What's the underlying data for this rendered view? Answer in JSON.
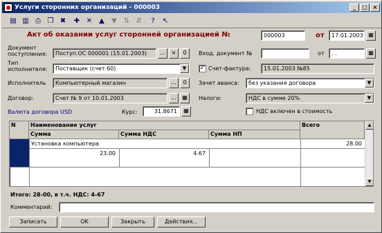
{
  "window": {
    "title": "Услуги сторонних организаций - 000003",
    "min_glyph": "_",
    "max_glyph": "□",
    "close_glyph": "×"
  },
  "toolbar": {
    "icons": [
      "save-icon",
      "save-close-icon",
      "print-icon",
      "copy-icon",
      "delete-icon",
      "new-row-icon",
      "delete-row-icon",
      "up-icon",
      "down-icon",
      "sort-asc-icon",
      "sort-desc-icon",
      "help-icon",
      "whats-this-icon"
    ],
    "glyphs": [
      "▤",
      "▥",
      "⎙",
      "❐",
      "✖",
      "✚",
      "✕",
      "▲",
      "▼",
      "⇅",
      "⇵",
      "?",
      "↖"
    ]
  },
  "header": {
    "heading": "Акт об оказании услуг сторонней организацией №",
    "number": "000003",
    "from_label": "от",
    "date": "17.01.2003"
  },
  "form": {
    "doc_receipt_label_1": "Документ",
    "doc_receipt_label_2": "поступления:",
    "doc_receipt_value": "Поступ.ОС 000001 (15.01.2003)",
    "incoming_doc_label": "Вход. документ №",
    "incoming_doc_value": "",
    "incoming_from_label": "от",
    "incoming_date": ". .",
    "executor_type_label_1": "Тип",
    "executor_type_label_2": "исполнителя:",
    "executor_type_value": "Поставщик (счет 60)",
    "invoice_label": "Счет-фактура:",
    "invoice_checked": "✓",
    "invoice_value": "15.01.2003 №85",
    "executor_label": "Исполнитель",
    "executor_value": "Компьютерный магазин",
    "advance_label": "Зачет аванса:",
    "advance_value": "без указания договора",
    "contract_label": "Договор:",
    "contract_value": "Счет № 9 от 10.01.2003",
    "taxes_label": "Налоги:",
    "taxes_value": "НДС в сумме 20%",
    "currency_label": "Валюта договора USD",
    "rate_label": "Курс:",
    "rate_value": "31.8671",
    "vat_included_label": "НДС включен в стоимость",
    "vat_included_checked": ""
  },
  "table": {
    "col_num": "N",
    "col_service": "Наименование услуг",
    "col_total": "Всего",
    "col_sum": "Сумма",
    "col_vat": "Сумма НДС",
    "col_np": "Сумма НП",
    "rows": [
      {
        "service": "Установка компьютера",
        "total": "28.00",
        "sum": "23.00",
        "vat": "4.67",
        "np": ""
      }
    ]
  },
  "totals": {
    "text": "Итого: 28-00, в т.ч. НДС: 4-67"
  },
  "comment": {
    "label": "Комментарий:",
    "value": ""
  },
  "buttons": {
    "write": "Записать",
    "ok": "OK",
    "close": "Закрыть",
    "actions": "Действия..."
  },
  "small_buttons": {
    "select": "...",
    "clear": "×",
    "zero": "0",
    "calc": "▦",
    "dropdown": "▼",
    "scroll_up": "▲",
    "scroll_down": "▼"
  }
}
